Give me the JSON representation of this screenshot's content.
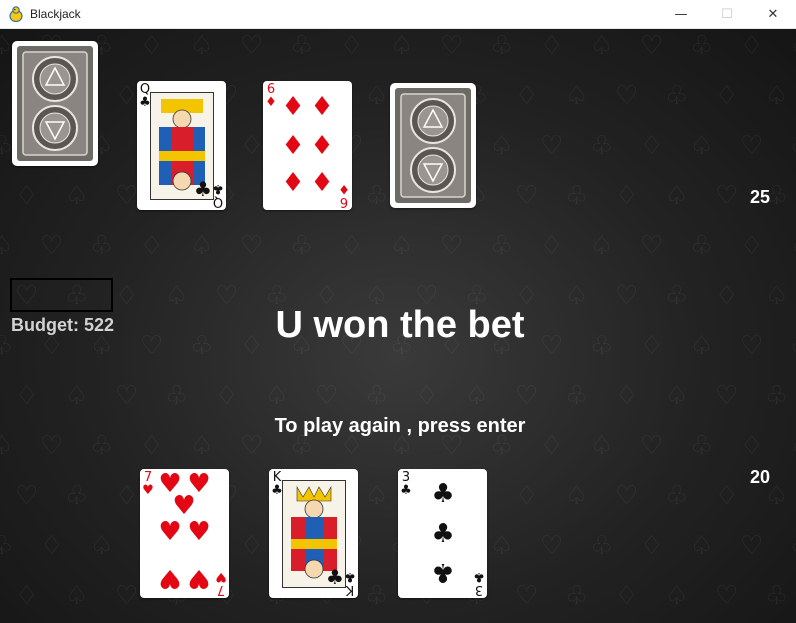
{
  "window": {
    "title": "Blackjack",
    "icon": "pygame-snake-icon",
    "controls": [
      "minimize-icon",
      "maximize-icon",
      "close-icon"
    ]
  },
  "dealer": {
    "score": "25",
    "cards": [
      {
        "face_down": true
      },
      {
        "rank": "Q",
        "suit": "♣",
        "color": "black"
      },
      {
        "rank": "6",
        "suit": "♦",
        "color": "red"
      },
      {
        "face_down": true
      }
    ]
  },
  "player": {
    "score": "20",
    "cards": [
      {
        "rank": "7",
        "suit": "♥",
        "color": "red"
      },
      {
        "rank": "K",
        "suit": "♣",
        "color": "black"
      },
      {
        "rank": "3",
        "suit": "♣",
        "color": "black"
      }
    ]
  },
  "bet_input": {
    "value": ""
  },
  "budget": "Budget: 522",
  "result_message": "U won the bet",
  "prompt": "To play again , press enter",
  "colors": {
    "felt": "#1c1c1c",
    "red_suit": "#e30613",
    "text": "#ffffff"
  }
}
